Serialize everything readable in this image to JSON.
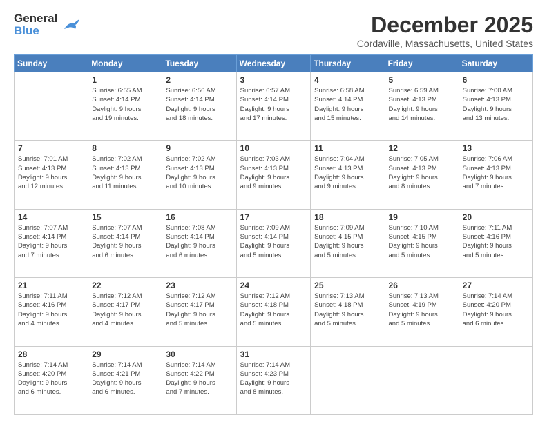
{
  "header": {
    "logo_line1": "General",
    "logo_line2": "Blue",
    "month": "December 2025",
    "location": "Cordaville, Massachusetts, United States"
  },
  "weekdays": [
    "Sunday",
    "Monday",
    "Tuesday",
    "Wednesday",
    "Thursday",
    "Friday",
    "Saturday"
  ],
  "weeks": [
    [
      {
        "day": "",
        "info": ""
      },
      {
        "day": "1",
        "info": "Sunrise: 6:55 AM\nSunset: 4:14 PM\nDaylight: 9 hours\nand 19 minutes."
      },
      {
        "day": "2",
        "info": "Sunrise: 6:56 AM\nSunset: 4:14 PM\nDaylight: 9 hours\nand 18 minutes."
      },
      {
        "day": "3",
        "info": "Sunrise: 6:57 AM\nSunset: 4:14 PM\nDaylight: 9 hours\nand 17 minutes."
      },
      {
        "day": "4",
        "info": "Sunrise: 6:58 AM\nSunset: 4:14 PM\nDaylight: 9 hours\nand 15 minutes."
      },
      {
        "day": "5",
        "info": "Sunrise: 6:59 AM\nSunset: 4:13 PM\nDaylight: 9 hours\nand 14 minutes."
      },
      {
        "day": "6",
        "info": "Sunrise: 7:00 AM\nSunset: 4:13 PM\nDaylight: 9 hours\nand 13 minutes."
      }
    ],
    [
      {
        "day": "7",
        "info": "Sunrise: 7:01 AM\nSunset: 4:13 PM\nDaylight: 9 hours\nand 12 minutes."
      },
      {
        "day": "8",
        "info": "Sunrise: 7:02 AM\nSunset: 4:13 PM\nDaylight: 9 hours\nand 11 minutes."
      },
      {
        "day": "9",
        "info": "Sunrise: 7:02 AM\nSunset: 4:13 PM\nDaylight: 9 hours\nand 10 minutes."
      },
      {
        "day": "10",
        "info": "Sunrise: 7:03 AM\nSunset: 4:13 PM\nDaylight: 9 hours\nand 9 minutes."
      },
      {
        "day": "11",
        "info": "Sunrise: 7:04 AM\nSunset: 4:13 PM\nDaylight: 9 hours\nand 9 minutes."
      },
      {
        "day": "12",
        "info": "Sunrise: 7:05 AM\nSunset: 4:13 PM\nDaylight: 9 hours\nand 8 minutes."
      },
      {
        "day": "13",
        "info": "Sunrise: 7:06 AM\nSunset: 4:13 PM\nDaylight: 9 hours\nand 7 minutes."
      }
    ],
    [
      {
        "day": "14",
        "info": "Sunrise: 7:07 AM\nSunset: 4:14 PM\nDaylight: 9 hours\nand 7 minutes."
      },
      {
        "day": "15",
        "info": "Sunrise: 7:07 AM\nSunset: 4:14 PM\nDaylight: 9 hours\nand 6 minutes."
      },
      {
        "day": "16",
        "info": "Sunrise: 7:08 AM\nSunset: 4:14 PM\nDaylight: 9 hours\nand 6 minutes."
      },
      {
        "day": "17",
        "info": "Sunrise: 7:09 AM\nSunset: 4:14 PM\nDaylight: 9 hours\nand 5 minutes."
      },
      {
        "day": "18",
        "info": "Sunrise: 7:09 AM\nSunset: 4:15 PM\nDaylight: 9 hours\nand 5 minutes."
      },
      {
        "day": "19",
        "info": "Sunrise: 7:10 AM\nSunset: 4:15 PM\nDaylight: 9 hours\nand 5 minutes."
      },
      {
        "day": "20",
        "info": "Sunrise: 7:11 AM\nSunset: 4:16 PM\nDaylight: 9 hours\nand 5 minutes."
      }
    ],
    [
      {
        "day": "21",
        "info": "Sunrise: 7:11 AM\nSunset: 4:16 PM\nDaylight: 9 hours\nand 4 minutes."
      },
      {
        "day": "22",
        "info": "Sunrise: 7:12 AM\nSunset: 4:17 PM\nDaylight: 9 hours\nand 4 minutes."
      },
      {
        "day": "23",
        "info": "Sunrise: 7:12 AM\nSunset: 4:17 PM\nDaylight: 9 hours\nand 5 minutes."
      },
      {
        "day": "24",
        "info": "Sunrise: 7:12 AM\nSunset: 4:18 PM\nDaylight: 9 hours\nand 5 minutes."
      },
      {
        "day": "25",
        "info": "Sunrise: 7:13 AM\nSunset: 4:18 PM\nDaylight: 9 hours\nand 5 minutes."
      },
      {
        "day": "26",
        "info": "Sunrise: 7:13 AM\nSunset: 4:19 PM\nDaylight: 9 hours\nand 5 minutes."
      },
      {
        "day": "27",
        "info": "Sunrise: 7:14 AM\nSunset: 4:20 PM\nDaylight: 9 hours\nand 6 minutes."
      }
    ],
    [
      {
        "day": "28",
        "info": "Sunrise: 7:14 AM\nSunset: 4:20 PM\nDaylight: 9 hours\nand 6 minutes."
      },
      {
        "day": "29",
        "info": "Sunrise: 7:14 AM\nSunset: 4:21 PM\nDaylight: 9 hours\nand 6 minutes."
      },
      {
        "day": "30",
        "info": "Sunrise: 7:14 AM\nSunset: 4:22 PM\nDaylight: 9 hours\nand 7 minutes."
      },
      {
        "day": "31",
        "info": "Sunrise: 7:14 AM\nSunset: 4:23 PM\nDaylight: 9 hours\nand 8 minutes."
      },
      {
        "day": "",
        "info": ""
      },
      {
        "day": "",
        "info": ""
      },
      {
        "day": "",
        "info": ""
      }
    ]
  ]
}
